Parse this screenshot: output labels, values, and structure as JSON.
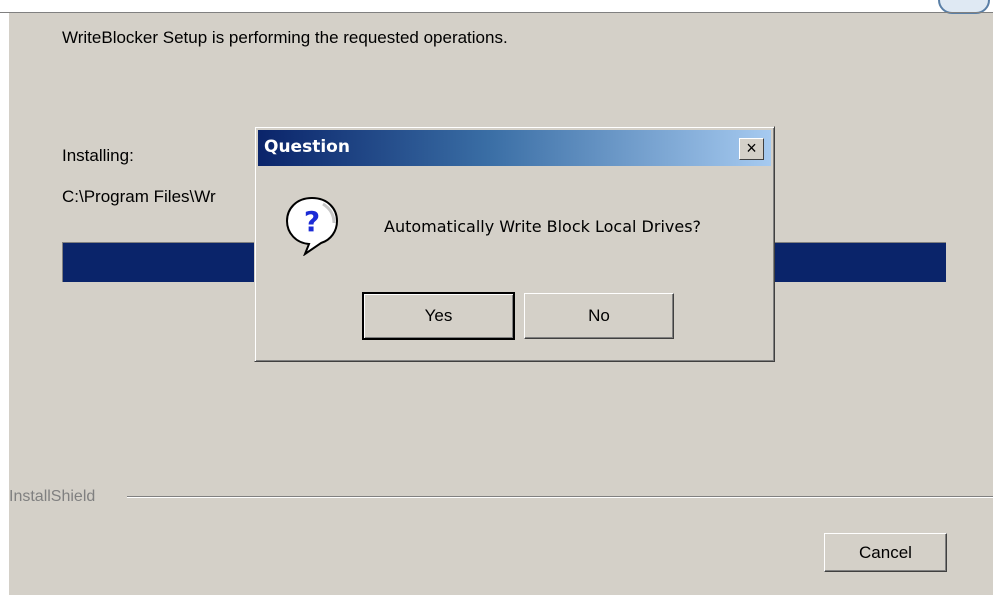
{
  "header": {
    "message": "WriteBlocker Setup is performing the requested operations."
  },
  "status": {
    "label": "Installing:",
    "path": "C:\\Program Files\\Wr",
    "progress": 1.0
  },
  "footer": {
    "brand": "InstallShield",
    "cancel_label": "Cancel"
  },
  "dialog": {
    "title": "Question",
    "close_glyph": "×",
    "icon": "question-icon",
    "message": "Automatically Write Block Local Drives?",
    "yes_label": "Yes",
    "no_label": "No"
  },
  "colors": {
    "window_bg": "#d4d0c8",
    "progress_fill": "#0a246a",
    "title_gradient_start": "#0a246a",
    "title_gradient_end": "#a6caf0"
  }
}
